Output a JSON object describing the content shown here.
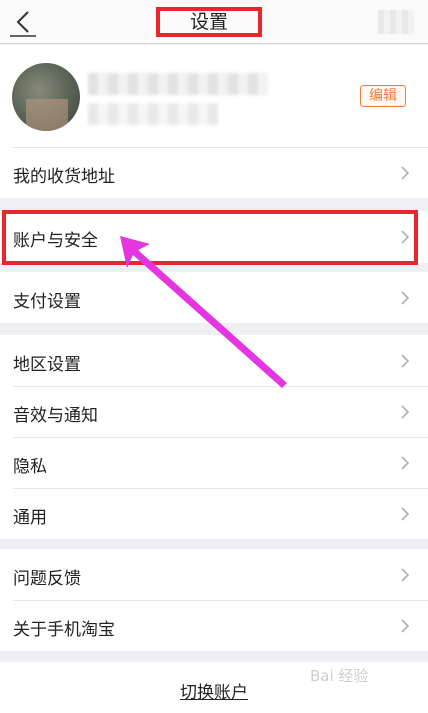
{
  "header": {
    "title": "设置"
  },
  "profile": {
    "edit_label": "编辑"
  },
  "menu": {
    "shipping_address": "我的收货地址",
    "account_security": "账户与安全",
    "payment_settings": "支付设置",
    "region_settings": "地区设置",
    "sound_notifications": "音效与通知",
    "privacy": "隐私",
    "general": "通用",
    "feedback": "问题反馈",
    "about": "关于手机淘宝"
  },
  "footer": {
    "switch_account": "切换账户"
  },
  "watermark": {
    "text": "Bai 经验"
  },
  "colors": {
    "highlight": "#e8262f",
    "arrow": "#e535e0",
    "edit_accent": "#f07a3a",
    "background": "#efeff4"
  }
}
